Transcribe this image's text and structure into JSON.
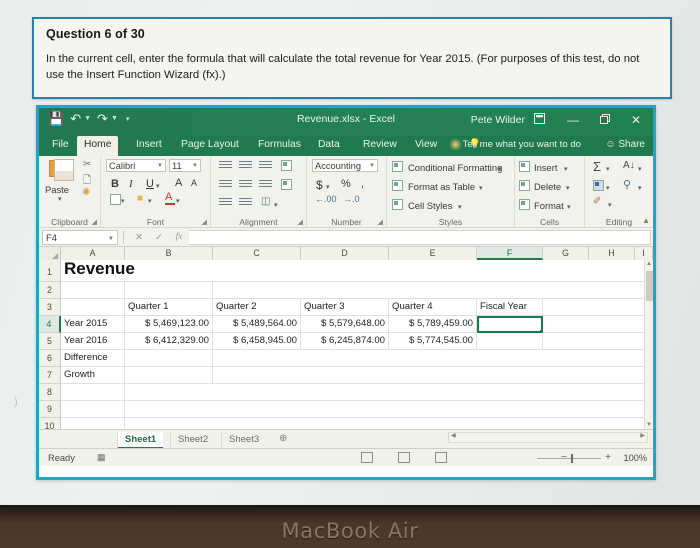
{
  "device": {
    "label": "MacBook Air"
  },
  "question": {
    "title": "Question 6 of 30",
    "text": "In the current cell, enter the formula that will calculate the total revenue for Year 2015. (For purposes of this test, do not use the Insert Function Wizard (fx).)"
  },
  "excel": {
    "title": "Revenue.xlsx - Excel",
    "user": "Pete Wilder",
    "quick_access": [
      "save-icon",
      "undo-icon",
      "redo-icon",
      "customize-qat-icon"
    ],
    "window_controls": {
      "ribbon_display": "⬜",
      "minimize": "—",
      "restore": "❐",
      "close": "✕"
    },
    "tabs": [
      {
        "label": "File",
        "active": false
      },
      {
        "label": "Home",
        "active": true
      },
      {
        "label": "Insert",
        "active": false
      },
      {
        "label": "Page Layout",
        "active": false
      },
      {
        "label": "Formulas",
        "active": false
      },
      {
        "label": "Data",
        "active": false
      },
      {
        "label": "Review",
        "active": false
      },
      {
        "label": "View",
        "active": false
      }
    ],
    "tell_me": "Tell me what you want to do",
    "share": "Share",
    "ribbon": {
      "groups": [
        {
          "name": "Clipboard"
        },
        {
          "name": "Font"
        },
        {
          "name": "Alignment"
        },
        {
          "name": "Number"
        },
        {
          "name": "Styles"
        },
        {
          "name": "Cells"
        },
        {
          "name": "Editing"
        }
      ],
      "clipboard": {
        "paste": "Paste"
      },
      "font": {
        "family": "Calibri",
        "size": "11",
        "bold": "B",
        "italic": "I",
        "underline": "U",
        "grow": "A",
        "shrink": "A"
      },
      "number": {
        "format": "Accounting",
        "currency": "$",
        "percent": "%",
        "comma": ","
      },
      "styles": {
        "conditional_formatting": "Conditional Formatting",
        "format_as_table": "Format as Table",
        "cell_styles": "Cell Styles"
      },
      "cells": {
        "insert": "Insert",
        "delete": "Delete",
        "format": "Format"
      },
      "editing": {
        "autosum": "Σ",
        "sort": "A↓",
        "fill": "↓",
        "find": "⚲",
        "clear": "✐"
      }
    },
    "formula_bar": {
      "name_box": "F4",
      "value": "",
      "cancel": "✕",
      "enter": "✓",
      "insert_function": "fx"
    },
    "grid": {
      "columns": [
        "A",
        "B",
        "C",
        "D",
        "E",
        "F",
        "G",
        "H",
        "I"
      ],
      "selected_column": "F",
      "rows": [
        "1",
        "2",
        "3",
        "4",
        "5",
        "6",
        "7",
        "8",
        "9",
        "10"
      ],
      "selected_row": "4",
      "selected_cell": "F4",
      "data": {
        "A1": "Revenue",
        "B3": "Quarter 1",
        "C3": "Quarter 2",
        "D3": "Quarter 3",
        "E3": "Quarter 4",
        "F3": "Fiscal Year",
        "A4": "Year 2015",
        "B4": "$ 5,469,123.00",
        "C4": "$ 5,489,564.00",
        "D4": "$ 5,579,648.00",
        "E4": "$ 5,789,459.00",
        "F4": "",
        "A5": "Year 2016",
        "B5": "$ 6,412,329.00",
        "C5": "$ 6,458,945.00",
        "D5": "$ 6,245,874.00",
        "E5": "$ 5,774,545.00",
        "A6": "Difference",
        "A7": "Growth"
      }
    },
    "sheets": [
      {
        "label": "Sheet1",
        "active": true
      },
      {
        "label": "Sheet2",
        "active": false
      },
      {
        "label": "Sheet3",
        "active": false
      }
    ],
    "add_sheet": "⊕",
    "status": {
      "mode": "Ready",
      "zoom": "100%",
      "zoom_out": "−",
      "zoom_in": "+"
    }
  },
  "colors": {
    "excel_green": "#217a4e",
    "card_border": "#2d7fa8",
    "window_border": "#2d9fc4",
    "selection": "#1d7a4d"
  }
}
